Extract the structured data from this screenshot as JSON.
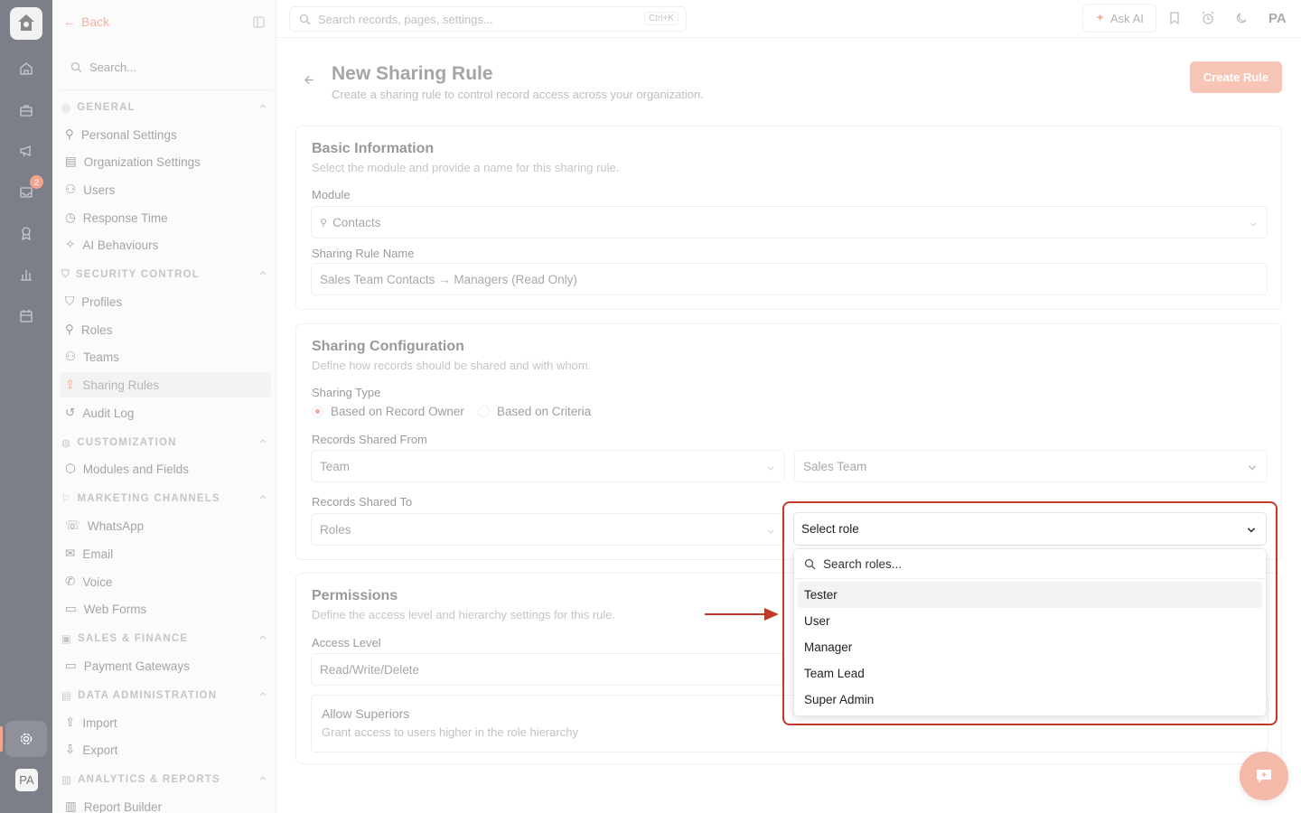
{
  "rail": {
    "badge_count": "2",
    "avatar_initials": "PA",
    "icons": [
      "home-icon",
      "briefcase-icon",
      "megaphone-icon",
      "inbox-icon",
      "award-icon",
      "chart-icon",
      "calendar-icon",
      "settings-icon"
    ]
  },
  "sidebar": {
    "back_label": "Back",
    "search_placeholder": "Search...",
    "groups": {
      "general": "GENERAL",
      "security": "SECURITY CONTROL",
      "customization": "CUSTOMIZATION",
      "marketing": "MARKETING CHANNELS",
      "sales": "SALES & FINANCE",
      "data": "DATA ADMINISTRATION",
      "analytics": "ANALYTICS & REPORTS"
    },
    "items": {
      "personal": "Personal Settings",
      "organization": "Organization Settings",
      "users": "Users",
      "response": "Response Time",
      "ai": "AI Behaviours",
      "profiles": "Profiles",
      "roles": "Roles",
      "teams": "Teams",
      "sharing": "Sharing Rules",
      "audit": "Audit Log",
      "modules": "Modules and Fields",
      "whatsapp": "WhatsApp",
      "email": "Email",
      "voice": "Voice",
      "webforms": "Web Forms",
      "payment": "Payment Gateways",
      "import": "Import",
      "export": "Export",
      "report": "Report Builder"
    }
  },
  "topbar": {
    "search_placeholder": "Search records, pages, settings...",
    "shortcut": "Ctrl+K",
    "ask_ai": "Ask AI",
    "user_initials": "PA"
  },
  "page": {
    "title": "New Sharing Rule",
    "subtitle": "Create a sharing rule to control record access across your organization.",
    "create_button": "Create Rule"
  },
  "basic": {
    "title": "Basic Information",
    "subtitle": "Select the module and provide a name for this sharing rule.",
    "module_label": "Module",
    "module_value": "Contacts",
    "name_label": "Sharing Rule Name",
    "name_value": "Sales Team Contacts → Managers (Read Only)"
  },
  "config": {
    "title": "Sharing Configuration",
    "subtitle": "Define how records should be shared and with whom.",
    "type_label": "Sharing Type",
    "type_owner": "Based on Record Owner",
    "type_criteria": "Based on Criteria",
    "from_label": "Records Shared From",
    "from_type": "Team",
    "from_value": "Sales Team",
    "to_label": "Records Shared To",
    "to_type": "Roles",
    "to_placeholder": "Select role"
  },
  "role_dropdown": {
    "search_placeholder": "Search roles...",
    "options": [
      "Tester",
      "User",
      "Manager",
      "Team Lead",
      "Super Admin"
    ]
  },
  "permissions": {
    "title": "Permissions",
    "subtitle": "Define the access level and hierarchy settings for this rule.",
    "access_label": "Access Level",
    "access_value": "Read/Write/Delete",
    "superiors_title": "Allow Superiors",
    "superiors_sub": "Grant access to users higher in the role hierarchy"
  },
  "colors": {
    "accent": "#f3a894",
    "highlight": "#c0392b",
    "rail": "#7c7f87"
  }
}
